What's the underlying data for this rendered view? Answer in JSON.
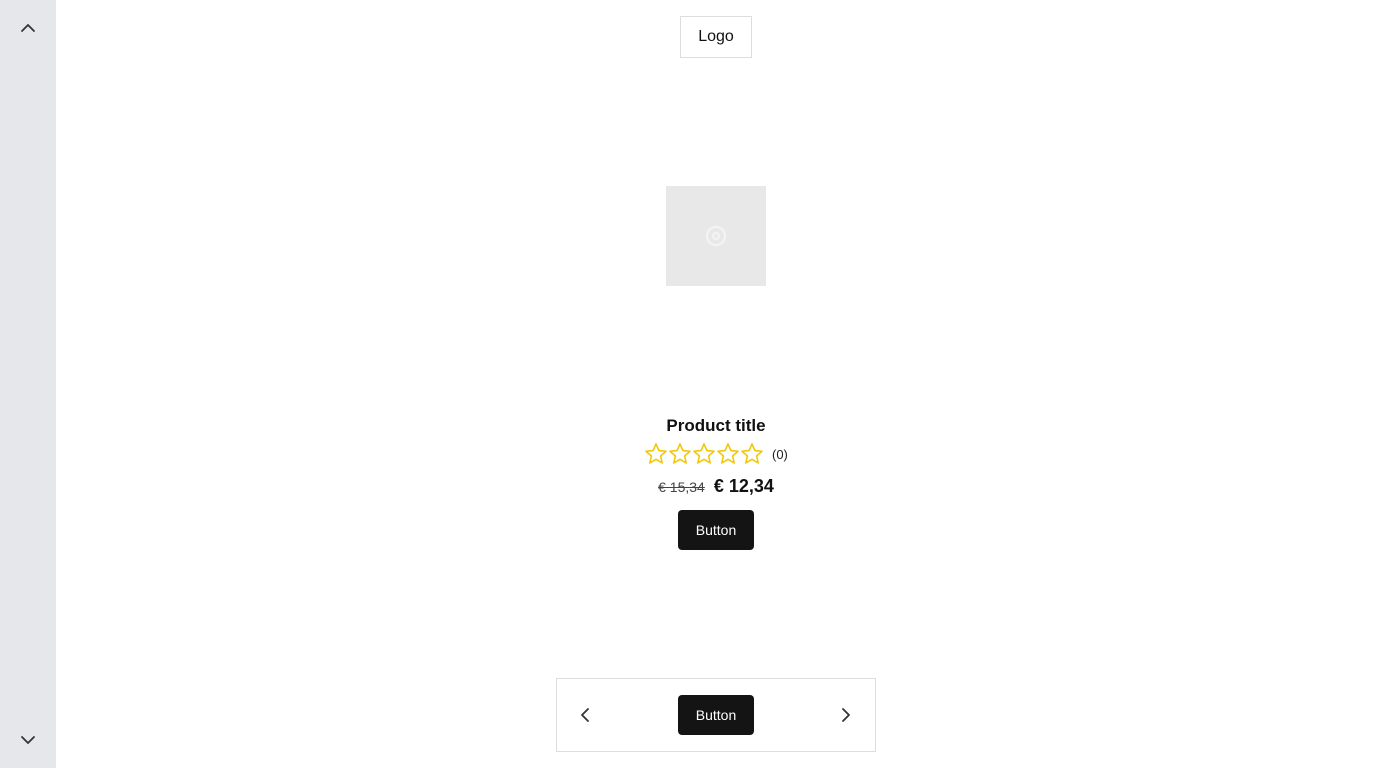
{
  "sidebar": {
    "up_icon": "chevron-up-icon",
    "down_icon": "chevron-down-icon"
  },
  "header": {
    "logo": "Logo"
  },
  "product": {
    "image_icon": "image-placeholder-icon",
    "title": "Product title",
    "rating": {
      "stars_total": 5,
      "stars_filled": 0,
      "count": "(0)",
      "star_color": "#f0c808"
    },
    "price_old": "€ 15,34",
    "price_new": "€ 12,34",
    "button_label": "Button"
  },
  "pager": {
    "prev_icon": "chevron-left-icon",
    "next_icon": "chevron-right-icon",
    "button_label": "Button"
  },
  "colors": {
    "sidebar_bg": "#e5e7eb",
    "button_bg": "#141414",
    "image_bg": "#e8e8e8"
  }
}
